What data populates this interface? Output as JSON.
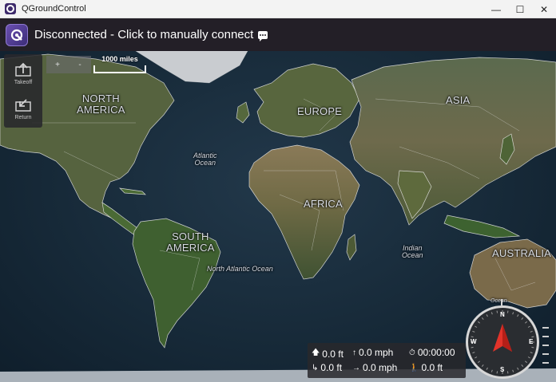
{
  "window": {
    "title": "QGroundControl",
    "controls": {
      "minimize": "—",
      "maximize": "☐",
      "close": "✕"
    }
  },
  "toolbar": {
    "connection_text": "Disconnected - Click to manually connect",
    "message_icon": "chat-bubble-icon",
    "logo_icon": "qgc-logo-icon"
  },
  "tools": {
    "takeoff": {
      "label": "Takeoff",
      "icon": "takeoff-icon"
    },
    "return": {
      "label": "Return",
      "icon": "return-icon"
    }
  },
  "map": {
    "zoom_in": "+",
    "zoom_out": "-",
    "scale_label": "1000 miles",
    "labels": {
      "north_america": "NORTH\nAMERICA",
      "south_america": "SOUTH\nAMERICA",
      "europe": "EUROPE",
      "asia": "ASIA",
      "africa": "AFRICA",
      "australia": "AUSTRALIA",
      "atlantic_ocean": "Atlantic\nOcean",
      "north_atlantic_ocean": "North Atlantic Ocean",
      "indian_ocean": "Indian\nOcean",
      "ocean_partial": "Ocean"
    },
    "colors": {
      "ocean": "#172a39",
      "land": "#4c5a3a",
      "desert": "#7a6a4c",
      "borders": "#e8e8e8"
    }
  },
  "telemetry": {
    "altitude": "0.0 ft",
    "ground_speed": "0.0 mph",
    "flight_time": "00:00:00",
    "distance_home": "0.0 ft",
    "climb_speed": "0.0 mph",
    "distance_vehicle": "0.0 ft"
  },
  "compass": {
    "n": "N",
    "e": "E",
    "s": "S",
    "w": "W",
    "arrow_color": "#e2332a"
  }
}
